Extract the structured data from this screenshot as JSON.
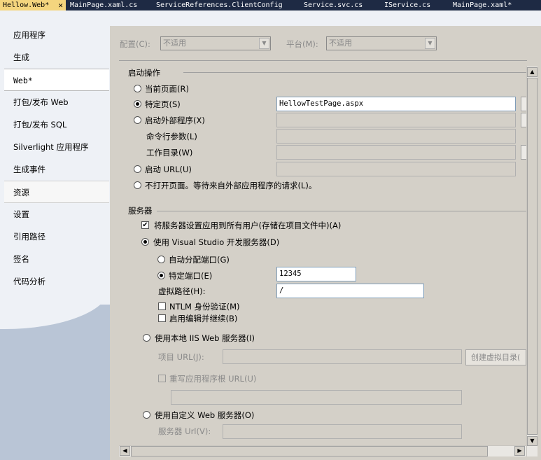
{
  "tabs": [
    {
      "label": "Hellow.Web*",
      "active": true
    },
    {
      "label": "MainPage.xaml.cs"
    },
    {
      "label": "ServiceReferences.ClientConfig"
    },
    {
      "label": "Service.svc.cs"
    },
    {
      "label": "IService.cs"
    },
    {
      "label": "MainPage.xaml*"
    }
  ],
  "close_icon": "✕",
  "sidebar": {
    "items": [
      {
        "label": "应用程序"
      },
      {
        "label": "生成"
      },
      {
        "label": "Web*",
        "selected": true
      },
      {
        "label": "打包/发布 Web"
      },
      {
        "label": "打包/发布 SQL"
      },
      {
        "label": "Silverlight 应用程序"
      },
      {
        "label": "生成事件"
      },
      {
        "label": "资源"
      },
      {
        "label": "设置"
      },
      {
        "label": "引用路径"
      },
      {
        "label": "签名"
      },
      {
        "label": "代码分析"
      }
    ]
  },
  "config": {
    "config_label": "配置(C):",
    "config_value": "不适用",
    "platform_label": "平台(M):",
    "platform_value": "不适用"
  },
  "start_action": {
    "header": "启动操作",
    "current_page": "当前页面(R)",
    "specific_page": "特定页(S)",
    "specific_page_value": "HellowTestPage.aspx",
    "start_external": "启动外部程序(X)",
    "cmd_args": "命令行参数(L)",
    "working_dir": "工作目录(W)",
    "start_url": "启动 URL(U)",
    "dont_open": "不打开页面。等待来自外部应用程序的请求(L)。"
  },
  "servers": {
    "header": "服务器",
    "apply_all": "将服务器设置应用到所有用户(存储在项目文件中)(A)",
    "use_vs": "使用 Visual Studio 开发服务器(D)",
    "auto_port": "自动分配端口(G)",
    "specific_port": "特定端口(E)",
    "port_value": "12345",
    "virtual_path": "虚拟路径(H):",
    "virtual_path_value": "/",
    "ntlm": "NTLM 身份验证(M)",
    "edit_continue": "启用编辑并继续(B)",
    "use_iis": "使用本地 IIS Web 服务器(I)",
    "project_url": "项目 URL(J):",
    "create_vdir": "创建虚拟目录(",
    "override_root": "重写应用程序根 URL(U)",
    "use_custom": "使用自定义 Web 服务器(O)",
    "server_url": "服务器 Url(V):"
  },
  "icons": {
    "arrow_up": "▲",
    "arrow_down": "▼",
    "arrow_left": "◀",
    "arrow_right": "▶",
    "checkmark": "✔"
  }
}
